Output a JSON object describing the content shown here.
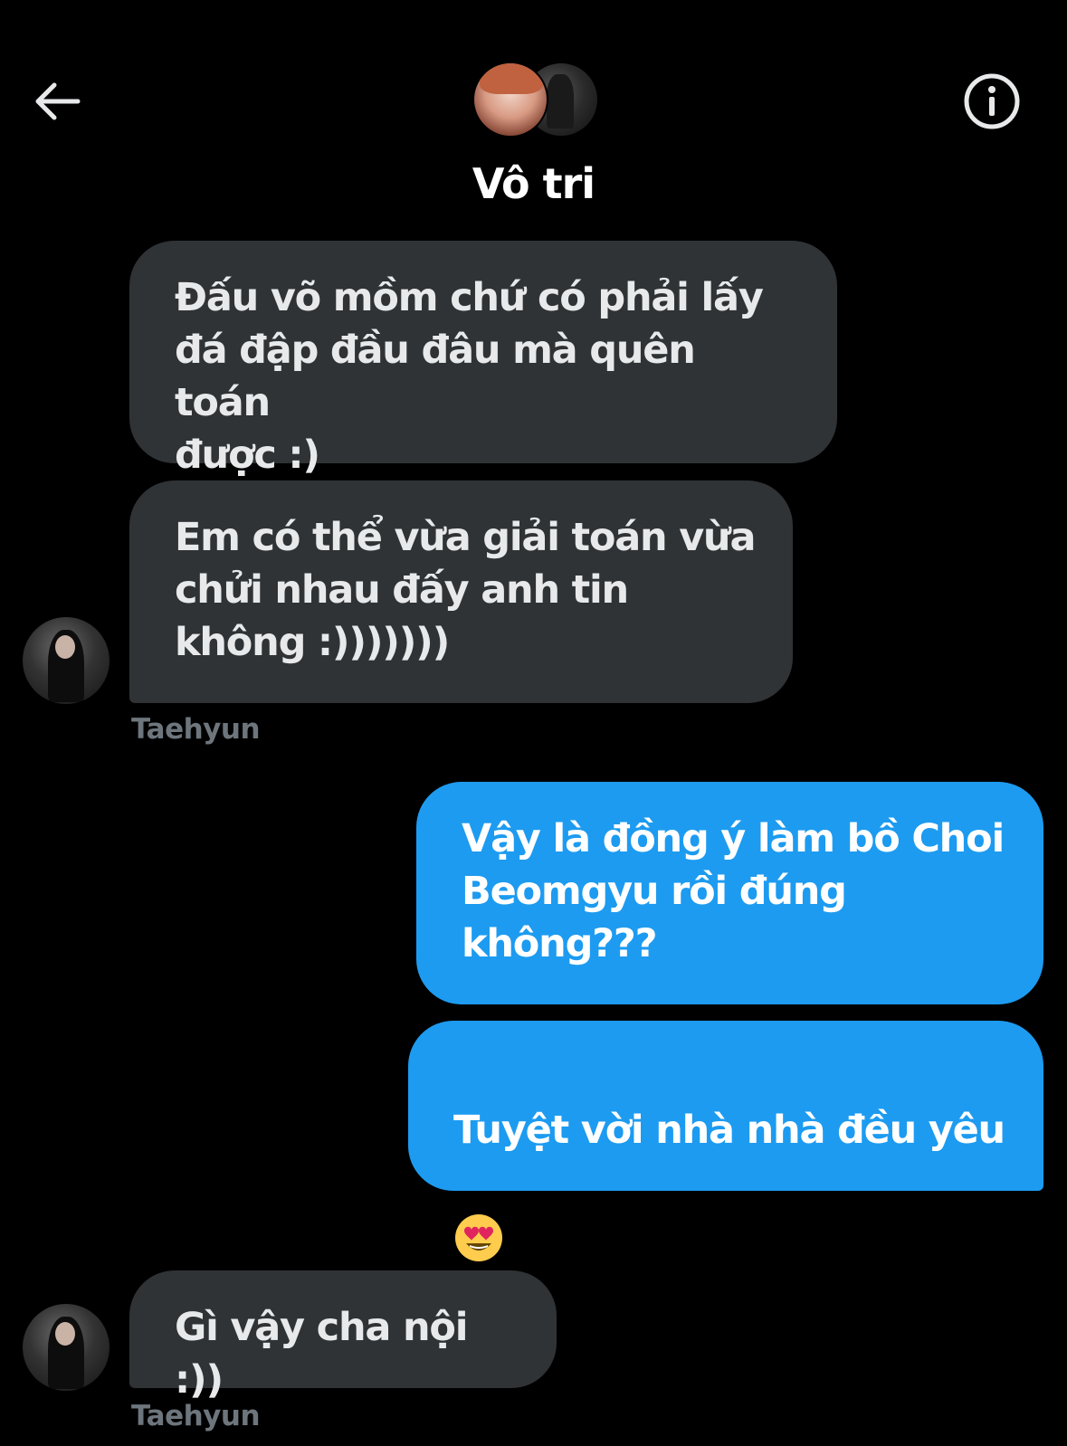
{
  "header": {
    "back_icon": "arrow-left-icon",
    "info_icon": "info-icon",
    "title": "Vô tri"
  },
  "messages": [
    {
      "direction": "incoming",
      "text": "Đấu võ mồm chứ có phải lấy\nđá đập đầu đâu mà quên toán\nđược :)"
    },
    {
      "direction": "incoming",
      "text": "Em có thể vừa giải toán vừa\nchửi nhau đấy anh tin\nkhông :)))))))",
      "sender": "Taehyun"
    },
    {
      "direction": "outgoing",
      "text": "Vậy là đồng ý làm bồ Choi\nBeomgyu rồi đúng\nkhông???"
    },
    {
      "direction": "outgoing",
      "text": "Tuyệt vời nhà nhà đều yêu",
      "emoji": "heart-eyes-emoji"
    },
    {
      "direction": "incoming",
      "text": "Gì vậy cha nội :))",
      "sender": "Taehyun"
    }
  ],
  "colors": {
    "background": "#000000",
    "incoming_bubble": "#2f3336",
    "outgoing_bubble": "#1d9bf0",
    "sender_name": "#6e767d"
  }
}
